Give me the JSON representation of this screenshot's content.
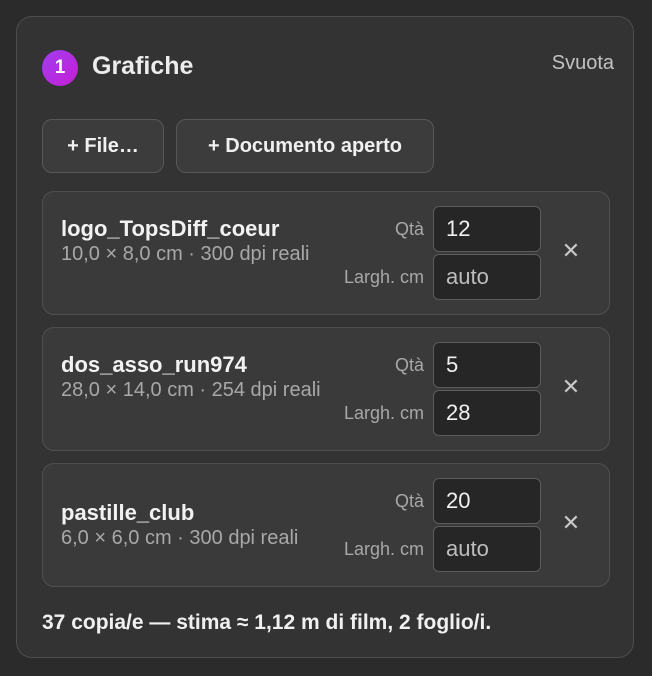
{
  "header": {
    "step": "1",
    "title": "Grafiche",
    "clear_label": "Svuota"
  },
  "buttons": {
    "add_file": "+ File…",
    "add_open_doc": "+ Documento aperto"
  },
  "labels": {
    "qty": "Qtà",
    "width": "Largh. cm"
  },
  "items": [
    {
      "name": "logo_TopsDiff_coeur",
      "meta": "10,0 × 8,0 cm · 300 dpi reali",
      "qty": "12",
      "width": "",
      "width_placeholder": "auto"
    },
    {
      "name": "dos_asso_run974",
      "meta": "28,0 × 14,0 cm · 254 dpi reali",
      "qty": "5",
      "width": "28",
      "width_placeholder": "auto"
    },
    {
      "name": "pastille_club",
      "meta": "6,0 × 6,0 cm · 300 dpi reali",
      "qty": "20",
      "width": "",
      "width_placeholder": "auto"
    }
  ],
  "icons": {
    "remove": "close-icon"
  },
  "colors": {
    "accent": "#b12de6",
    "panel": "#333333",
    "background": "#2b2b2b"
  },
  "summary": "37 copia/e — stima ≈ 1,12 m di film, 2 foglio/i."
}
